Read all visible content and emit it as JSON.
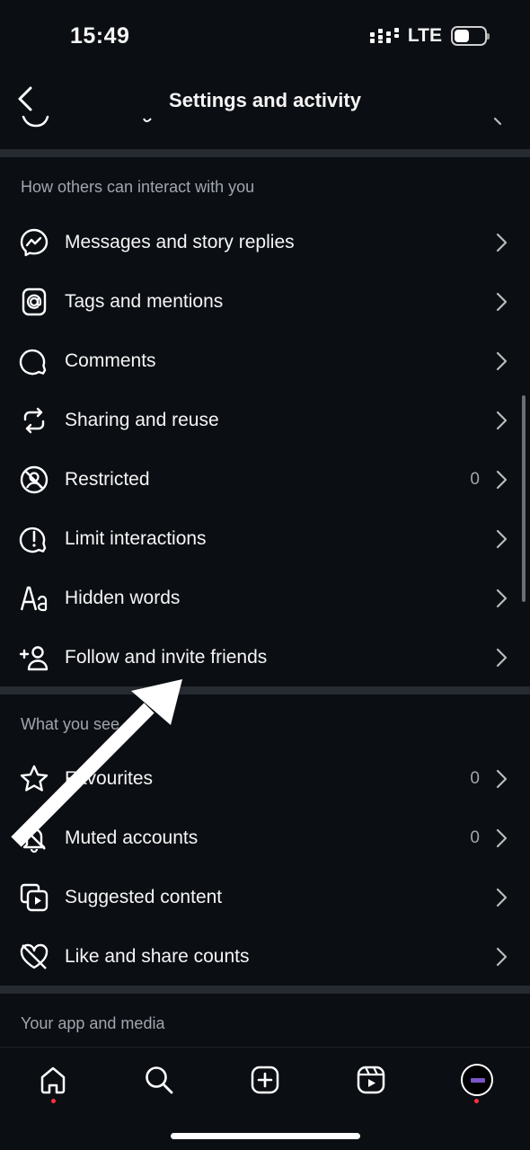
{
  "status_bar": {
    "time": "15:49",
    "network": "LTE",
    "battery_level": 0.5
  },
  "header": {
    "title": "Settings and activity",
    "back_icon": "chevron-left-icon"
  },
  "sections": [
    {
      "title": "How others can interact with you",
      "items": [
        {
          "label": "Messages and story replies",
          "icon": "messenger-icon",
          "count": ""
        },
        {
          "label": "Tags and mentions",
          "icon": "at-sign-icon",
          "count": ""
        },
        {
          "label": "Comments",
          "icon": "comment-icon",
          "count": ""
        },
        {
          "label": "Sharing and reuse",
          "icon": "repost-icon",
          "count": ""
        },
        {
          "label": "Restricted",
          "icon": "restricted-icon",
          "count": "0"
        },
        {
          "label": "Limit interactions",
          "icon": "alert-bubble-icon",
          "count": ""
        },
        {
          "label": "Hidden words",
          "icon": "text-aa-icon",
          "count": ""
        },
        {
          "label": "Follow and invite friends",
          "icon": "add-person-icon",
          "count": ""
        }
      ]
    },
    {
      "title": "What you see",
      "items": [
        {
          "label": "Favourites",
          "icon": "star-icon",
          "count": "0"
        },
        {
          "label": "Muted accounts",
          "icon": "muted-bell-icon",
          "count": "0"
        },
        {
          "label": "Suggested content",
          "icon": "media-stack-icon",
          "count": ""
        },
        {
          "label": "Like and share counts",
          "icon": "heart-off-icon",
          "count": ""
        }
      ]
    },
    {
      "title": "Your app and media",
      "items": []
    }
  ],
  "tab_bar": [
    {
      "name": "home-tab",
      "icon": "home-icon",
      "has_dot": true
    },
    {
      "name": "search-tab",
      "icon": "search-icon",
      "has_dot": false
    },
    {
      "name": "create-tab",
      "icon": "plus-square-icon",
      "has_dot": false
    },
    {
      "name": "reels-tab",
      "icon": "reels-icon",
      "has_dot": false
    },
    {
      "name": "profile-tab",
      "icon": "avatar",
      "has_dot": true
    }
  ],
  "colors": {
    "background": "#0b0e13",
    "separator": "#262a31",
    "secondary_text": "#a1a6ae",
    "notification_dot": "#ff3040",
    "annotation_arrow": "#ffffff"
  }
}
